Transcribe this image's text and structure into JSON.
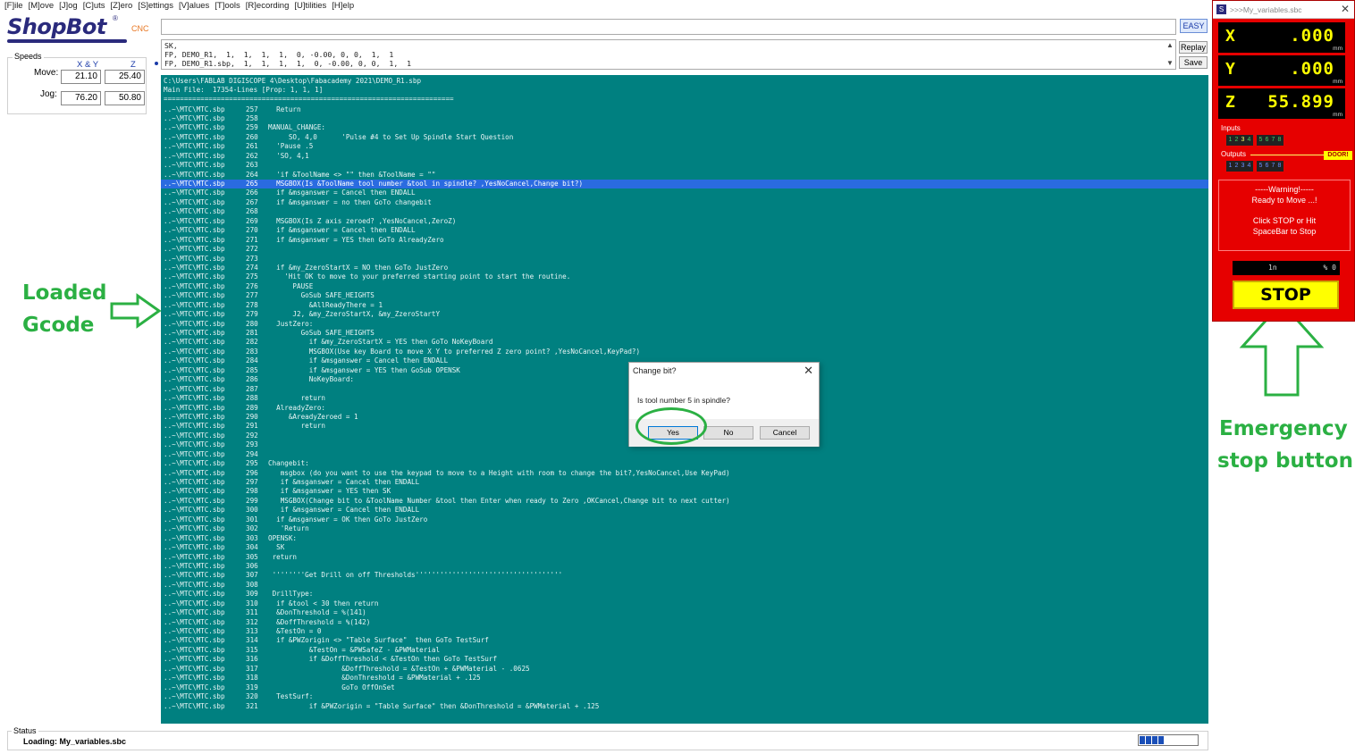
{
  "menu": [
    "[F]ile",
    "[M]ove",
    "[J]og",
    "[C]uts",
    "[Z]ero",
    "[S]ettings",
    "[V]alues",
    "[T]ools",
    "[R]ecording",
    "[U]tilities",
    "[H]elp"
  ],
  "logo": {
    "text": "ShopBot",
    "reg": "®",
    "suffix": "CNC"
  },
  "speeds": {
    "title": "Speeds",
    "col_xy": "X & Y",
    "col_z": "Z",
    "move_label": "Move:",
    "jog_label": "Jog:",
    "move_xy": "21.10",
    "move_z": "25.40",
    "jog_xy": "76.20",
    "jog_z": "50.80"
  },
  "command": {
    "value": "",
    "easy_label": "EASY"
  },
  "history": {
    "lines": "SK,\nFP, DEMO_R1,  1,  1,  1,  1,  0, -0.00, 0, 0,  1,  1\nFP, DEMO_R1.sbp,  1,  1,  1,  1,  0, -0.00, 0, 0,  1,  1",
    "scroll_up": "▲",
    "scroll_down": "▼",
    "replay_label": "Replay",
    "save_label": "Save"
  },
  "code": {
    "header": "C:\\Users\\FABLAB DIGISCOPE 4\\Desktop\\Fabacademy 2021\\DEMO_R1.sbp\nMain File:  17354-Lines [Prop: 1, 1, 1]\n=======================================================================",
    "file_prefix": "..~\\MTC\\MTC.sbp",
    "highlight_line": "265",
    "lines": [
      [
        "257",
        "  Return"
      ],
      [
        "258",
        ""
      ],
      [
        "259",
        "MANUAL_CHANGE:"
      ],
      [
        "260",
        "     SO, 4,0      'Pulse #4 to Set Up Spindle Start Question"
      ],
      [
        "261",
        "  'Pause .5"
      ],
      [
        "262",
        "  'SO, 4,1"
      ],
      [
        "263",
        ""
      ],
      [
        "264",
        "  'if &ToolName <> \"\" then &ToolName = \"\""
      ],
      [
        "265",
        "  MSGBOX(Is &ToolName tool number &tool in spindle? ,YesNoCancel,Change bit?)"
      ],
      [
        "266",
        "  if &msganswer = Cancel then ENDALL"
      ],
      [
        "267",
        "  if &msganswer = no then GoTo changebit"
      ],
      [
        "268",
        ""
      ],
      [
        "269",
        "  MSGBOX(Is Z axis zeroed? ,YesNoCancel,ZeroZ)"
      ],
      [
        "270",
        "  if &msganswer = Cancel then ENDALL"
      ],
      [
        "271",
        "  if &msganswer = YES then GoTo AlreadyZero"
      ],
      [
        "272",
        ""
      ],
      [
        "273",
        ""
      ],
      [
        "274",
        "  if &my_ZzeroStartX = NO then GoTo JustZero"
      ],
      [
        "275",
        "    'Hit OK to move to your preferred starting point to start the routine."
      ],
      [
        "276",
        "      PAUSE"
      ],
      [
        "277",
        "        GoSub SAFE_HEIGHTS"
      ],
      [
        "278",
        "          &AllReadyThere = 1"
      ],
      [
        "279",
        "      J2, &my_ZzeroStartX, &my_ZzeroStartY"
      ],
      [
        "280",
        "  JustZero:"
      ],
      [
        "281",
        "        GoSub SAFE_HEIGHTS"
      ],
      [
        "282",
        "          if &my_ZzeroStartX = YES then GoTo NoKeyBoard"
      ],
      [
        "283",
        "          MSGBOX(Use key Board to move X Y to preferred Z zero point? ,YesNoCancel,KeyPad?)"
      ],
      [
        "284",
        "          if &msganswer = Cancel then ENDALL"
      ],
      [
        "285",
        "          if &msganswer = YES then GoSub OPENSK"
      ],
      [
        "286",
        "          NoKeyBoard:"
      ],
      [
        "287",
        ""
      ],
      [
        "288",
        "        return"
      ],
      [
        "289",
        "  AlreadyZero:"
      ],
      [
        "290",
        "     &AreadyZeroed = 1"
      ],
      [
        "291",
        "        return"
      ],
      [
        "292",
        ""
      ],
      [
        "293",
        ""
      ],
      [
        "294",
        ""
      ],
      [
        "295",
        "Changebit:"
      ],
      [
        "296",
        "   msgbox (do you want to use the keypad to move to a Height with room to change the bit?,YesNoCancel,Use KeyPad)"
      ],
      [
        "297",
        "   if &msganswer = Cancel then ENDALL"
      ],
      [
        "298",
        "   if &msganswer = YES then SK"
      ],
      [
        "299",
        "   MSGBOX(Change bit to &ToolName Number &tool then Enter when ready to Zero ,OKCancel,Change bit to next cutter)"
      ],
      [
        "300",
        "   if &msganswer = Cancel then ENDALL"
      ],
      [
        "301",
        "  if &msganswer = OK then GoTo JustZero"
      ],
      [
        "302",
        "   'Return"
      ],
      [
        "303",
        "OPENSK:"
      ],
      [
        "304",
        "  SK"
      ],
      [
        "305",
        " return"
      ],
      [
        "306",
        ""
      ],
      [
        "307",
        " ''''''''Get Drill on off Thresholds''''''''''''''''''''''''''''''''''''"
      ],
      [
        "308",
        ""
      ],
      [
        "309",
        " DrillType:"
      ],
      [
        "310",
        "  if &tool < 30 then return"
      ],
      [
        "311",
        "  &DonThreshold = %(141)"
      ],
      [
        "312",
        "  &DoffThreshold = %(142)"
      ],
      [
        "313",
        "  &TestOn = 0"
      ],
      [
        "314",
        "  if &PWZorigin <> \"Table Surface\"  then GoTo TestSurf"
      ],
      [
        "315",
        "          &TestOn = &PWSafeZ - &PWMaterial"
      ],
      [
        "316",
        "          if &DoffThreshold < &TestOn then GoTo TestSurf"
      ],
      [
        "317",
        "                  &DoffThreshold = &TestOn + &PWMaterial - .0625"
      ],
      [
        "318",
        "                  &DonThreshold = &PWMaterial + .125"
      ],
      [
        "319",
        "                  GoTo OffOnSet"
      ],
      [
        "320",
        "  TestSurf:"
      ],
      [
        "321",
        "          if &PWZorigin = \"Table Surface\" then &DonThreshold = &PWMaterial + .125"
      ]
    ]
  },
  "status": {
    "title": "Status",
    "text": "Loading: My_variables.sbc",
    "progress_segments": 4
  },
  "annotations": {
    "loaded_gcode": [
      "Loaded",
      "Gcode"
    ],
    "emergency": [
      "Emergency",
      "stop button"
    ]
  },
  "dialog": {
    "title": "Change bit?",
    "close": "✕",
    "message": "Is  tool number 5 in spindle?",
    "yes_label": "Yes",
    "no_label": "No",
    "cancel_label": "Cancel"
  },
  "dro": {
    "title": ">>>My_variables.sbc",
    "close": "✕",
    "x_label": "X",
    "x_value": ".000",
    "y_label": "Y",
    "y_value": ".000",
    "z_label": "Z",
    "z_value": "55.899",
    "unit": "mm",
    "inputs_label": "Inputs",
    "outputs_label": "Outputs",
    "input_bits_a": [
      "1",
      "2",
      "3",
      "4"
    ],
    "input_bits_b": [
      "5",
      "6",
      "7",
      "8"
    ],
    "output_bits_a": [
      "1",
      "2",
      "3",
      "4"
    ],
    "output_bits_b": [
      "5",
      "6",
      "7",
      "8"
    ],
    "door_label": "DOOR!",
    "warning_lines": [
      "-----Warning!-----",
      "Ready to Move ...!",
      "",
      "Click STOP or Hit",
      "SpaceBar to Stop"
    ],
    "status_mode": "1n",
    "status_pct": "%  0",
    "stop_label": "STOP",
    "colors": {
      "panel": "#e60000",
      "readout": "#ffff00",
      "stop": "#ffff00"
    }
  },
  "accent_color": "#2bb043"
}
